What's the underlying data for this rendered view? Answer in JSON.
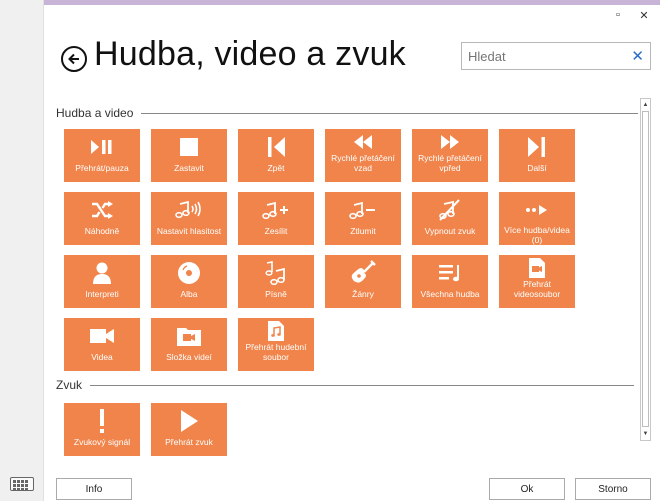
{
  "window": {
    "title": "Hudba, video a zvuk",
    "minimize_glyph": "▫",
    "close_glyph": "✕"
  },
  "search": {
    "placeholder": "Hledat",
    "clear_glyph": "✕"
  },
  "groups": [
    {
      "label": "Hudba a video",
      "tiles": [
        {
          "label": "Přehrát/pauza",
          "icon": "play-pause-icon"
        },
        {
          "label": "Zastavit",
          "icon": "stop-icon"
        },
        {
          "label": "Zpět",
          "icon": "previous-icon"
        },
        {
          "label": "Rychlé přetáčení vzad",
          "icon": "rewind-icon"
        },
        {
          "label": "Rychlé přetáčení vpřed",
          "icon": "fast-forward-icon"
        },
        {
          "label": "Další",
          "icon": "next-icon"
        },
        {
          "label": "Náhodně",
          "icon": "shuffle-icon"
        },
        {
          "label": "Nastavit hlasitost",
          "icon": "volume-icon"
        },
        {
          "label": "Zesílit",
          "icon": "volume-up-icon"
        },
        {
          "label": "Ztlumit",
          "icon": "volume-down-icon"
        },
        {
          "label": "Vypnout zvuk",
          "icon": "mute-icon"
        },
        {
          "label": "Více hudba/videa (0)",
          "icon": "more-icon"
        },
        {
          "label": "Interpreti",
          "icon": "artist-icon"
        },
        {
          "label": "Alba",
          "icon": "album-icon"
        },
        {
          "label": "Písně",
          "icon": "songs-icon"
        },
        {
          "label": "Žánry",
          "icon": "guitar-icon"
        },
        {
          "label": "Všechna hudba",
          "icon": "all-music-icon"
        },
        {
          "label": "Přehrát videosoubor",
          "icon": "video-file-icon"
        },
        {
          "label": "Videa",
          "icon": "video-camera-icon"
        },
        {
          "label": "Složka videí",
          "icon": "video-folder-icon"
        },
        {
          "label": "Přehrát hudební soubor",
          "icon": "music-file-icon"
        }
      ]
    },
    {
      "label": "Zvuk",
      "tiles": [
        {
          "label": "Zvukový signál",
          "icon": "alert-icon"
        },
        {
          "label": "Přehrát zvuk",
          "icon": "play-icon"
        }
      ]
    }
  ],
  "footer": {
    "info_label": "Info",
    "ok_label": "Ok",
    "cancel_label": "Storno"
  },
  "colors": {
    "tile": "#f0844a",
    "accent": "#2a6cc8"
  }
}
